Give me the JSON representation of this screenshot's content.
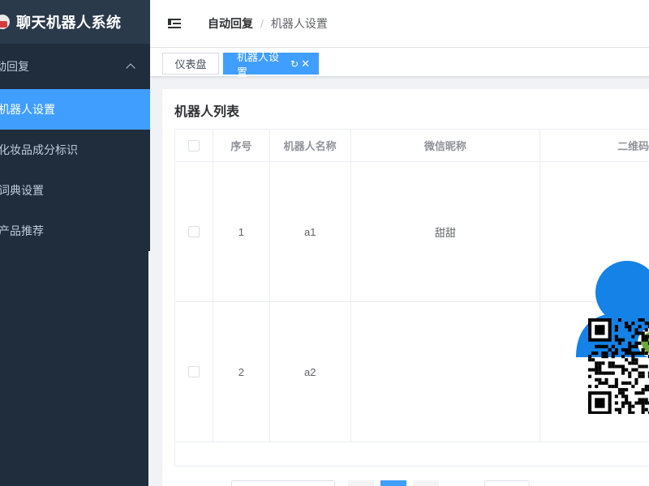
{
  "app": {
    "title": "聊天机器人系统"
  },
  "sidebar": {
    "group": {
      "label": "动回复",
      "expanded": true
    },
    "items": [
      {
        "label": "机器人设置",
        "active": true
      },
      {
        "label": "化妆品成分标识",
        "active": false
      },
      {
        "label": "词典设置",
        "active": false
      },
      {
        "label": "产品推荐",
        "active": false
      }
    ]
  },
  "breadcrumb": {
    "parent": "自动回复",
    "separator": "/",
    "current": "机器人设置"
  },
  "tags": {
    "dashboard": "仪表盘",
    "current": "机器人设置"
  },
  "card": {
    "title": "机器人列表"
  },
  "table": {
    "headers": {
      "index": "序号",
      "name": "机器人名称",
      "nickname": "微信昵称",
      "qrcode": "二维码"
    },
    "rows": [
      {
        "index": "1",
        "name": "a1",
        "nickname": "甜甜",
        "image": "user-avatar-icon"
      },
      {
        "index": "2",
        "name": "a2",
        "nickname": "",
        "image": "qr-code"
      }
    ]
  },
  "pagination": {
    "current_page": 1
  },
  "colors": {
    "sidebar_bg": "#1f2d3d",
    "accent": "#409eff",
    "avatar_blue": "#1482e6"
  }
}
